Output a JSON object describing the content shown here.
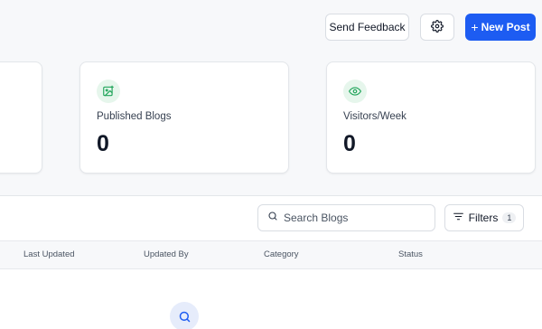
{
  "header": {
    "feedback_label": "Send Feedback",
    "new_post_plus": "+",
    "new_post_label": "New Post"
  },
  "stats": [
    {
      "label": "",
      "value": ""
    },
    {
      "label": "Published Blogs",
      "value": "0",
      "icon": "image-icon"
    },
    {
      "label": "Visitors/Week",
      "value": "0",
      "icon": "eye-icon"
    }
  ],
  "toolbar": {
    "search_placeholder": "Search Blogs",
    "filters_label": "Filters",
    "filters_count": "1"
  },
  "table": {
    "columns": [
      "Last Updated",
      "Updated By",
      "Category",
      "Status"
    ]
  },
  "colors": {
    "accent": "#1d5cf2",
    "stat_icon": "#22a55b",
    "stat_icon_bg": "#e6f6ec"
  }
}
